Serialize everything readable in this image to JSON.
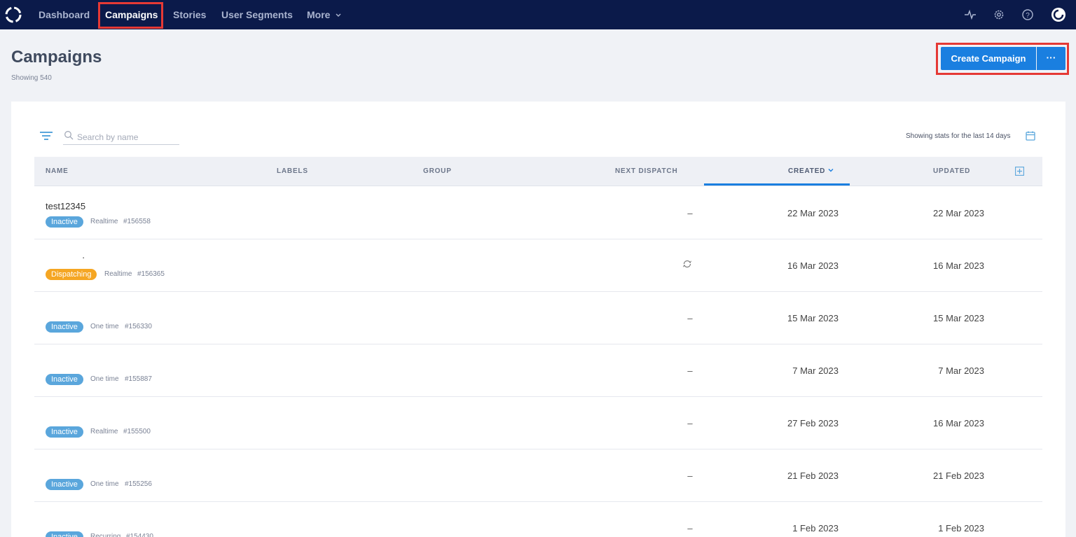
{
  "nav": {
    "items": [
      {
        "label": "Dashboard"
      },
      {
        "label": "Campaigns"
      },
      {
        "label": "Stories"
      },
      {
        "label": "User Segments"
      },
      {
        "label": "More"
      }
    ],
    "icons": [
      "activity-icon",
      "gear-icon",
      "help-icon",
      "user-avatar-icon"
    ]
  },
  "header": {
    "title": "Campaigns",
    "subtitle": "Showing 540",
    "create_label": "Create Campaign",
    "more_label": "···"
  },
  "toolbar": {
    "search_placeholder": "Search by name",
    "stats_text": "Showing stats for the last 14 days"
  },
  "table": {
    "columns": {
      "name": "NAME",
      "labels": "LABELS",
      "group": "GROUP",
      "next_dispatch": "NEXT DISPATCH",
      "created": "CREATED",
      "updated": "UPDATED"
    },
    "rows": [
      {
        "name": "test12345",
        "status": "Inactive",
        "type": "Realtime",
        "id": "#156558",
        "next": "–",
        "created": "22 Mar 2023",
        "updated": "22 Mar 2023"
      },
      {
        "name": "·",
        "status": "Dispatching",
        "type": "Realtime",
        "id": "#156365",
        "next": "",
        "created": "16 Mar 2023",
        "updated": "16 Mar 2023"
      },
      {
        "name": "",
        "status": "Inactive",
        "type": "One time",
        "id": "#156330",
        "next": "–",
        "created": "15 Mar 2023",
        "updated": "15 Mar 2023"
      },
      {
        "name": "",
        "status": "Inactive",
        "type": "One time",
        "id": "#155887",
        "next": "–",
        "created": "7 Mar 2023",
        "updated": "7 Mar 2023"
      },
      {
        "name": "",
        "status": "Inactive",
        "type": "Realtime",
        "id": "#155500",
        "next": "–",
        "created": "27 Feb 2023",
        "updated": "16 Mar 2023"
      },
      {
        "name": "",
        "status": "Inactive",
        "type": "One time",
        "id": "#155256",
        "next": "–",
        "created": "21 Feb 2023",
        "updated": "21 Feb 2023"
      },
      {
        "name": "",
        "status": "Inactive",
        "type": "Recurring",
        "id": "#154430",
        "next": "–",
        "created": "1 Feb 2023",
        "updated": "1 Feb 2023"
      }
    ]
  },
  "colors": {
    "nav_bg": "#0b1a4a",
    "accent": "#1a7fe0",
    "inactive": "#5aa6dc",
    "dispatching": "#f5a623",
    "highlight": "#e53935"
  }
}
